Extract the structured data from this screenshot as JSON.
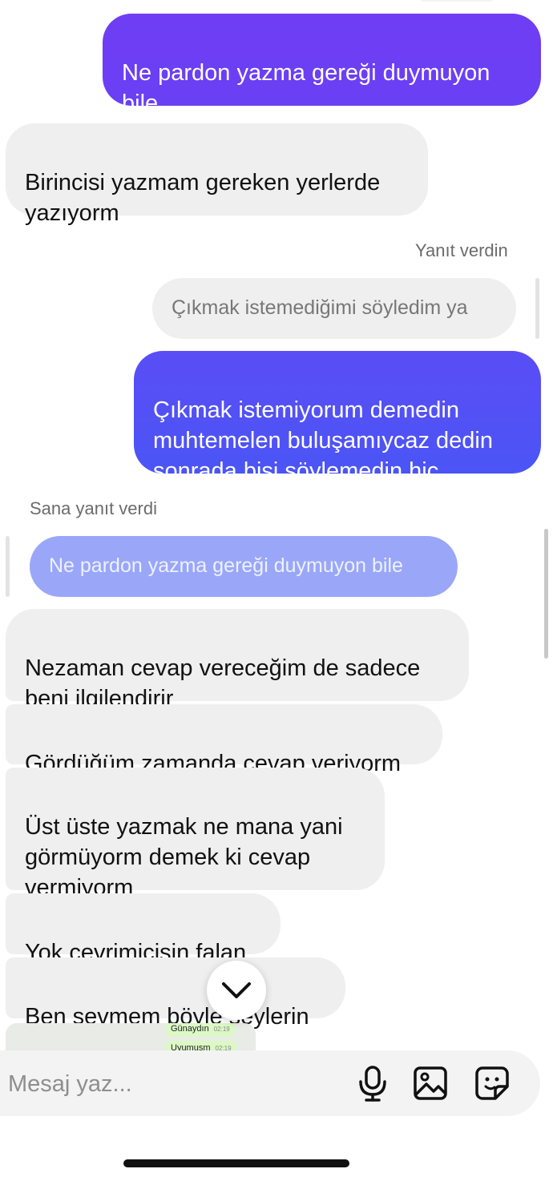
{
  "colors": {
    "outgoing_gradient_top": "#6f3df4",
    "outgoing_gradient_bottom": "#4c55f5",
    "incoming_bg": "#efefef",
    "quoted_outgoing_bg": "#9aa7f8"
  },
  "messages": [
    {
      "dir": "out",
      "text": "Ne pardon yazma gereği duymuyon bile"
    },
    {
      "dir": "in",
      "text": "Birincisi yazmam gereken yerlerde yazıyorm"
    },
    {
      "dir": "out",
      "text": "Çıkmak istemiyorum demedin muhtemelen buluşamıycaz dedin sonrada bişi söylemedin hiç"
    },
    {
      "dir": "in",
      "text": "Nezaman cevap vereceğim de sadece beni ilgilendirir"
    },
    {
      "dir": "in",
      "text": "Gördüğüm zamanda cevap veriyorm"
    },
    {
      "dir": "in",
      "text": "Üst üste yazmak ne mana yani görmüyorm demek ki cevap vermiyorm"
    },
    {
      "dir": "in",
      "text": "Yok çevrimiçisin falan"
    },
    {
      "dir": "in",
      "text": "Ben sevmem böyle şeylerin"
    }
  ],
  "replies": {
    "you_replied_label": "Yanıt verdin",
    "you_replied_quote": "Çıkmak istemediğimi söyledim ya",
    "they_replied_label": "Sana yanıt verdi",
    "they_replied_quote": "Ne pardon yazma gereği duymuyon bile"
  },
  "image_preview": {
    "lines": [
      {
        "text": "Günaydın",
        "time": "02:19"
      },
      {
        "text": "Uyumusm",
        "time": "02:19"
      }
    ]
  },
  "composer": {
    "placeholder": "Mesaj yaz...",
    "icons": [
      "microphone-icon",
      "gallery-icon",
      "sticker-icon"
    ]
  },
  "scroll_button_icon": "chevron-down-icon"
}
